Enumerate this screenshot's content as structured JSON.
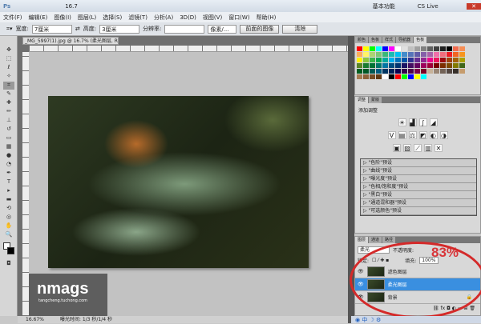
{
  "titlebar": {
    "app_logo": "Ps",
    "zoom_value": "16.7",
    "workspace": "基本功能",
    "cs_live": "CS Live"
  },
  "menu": [
    "文件(F)",
    "编辑(E)",
    "图像(I)",
    "图层(L)",
    "选择(S)",
    "滤镜(T)",
    "分析(A)",
    "3D(D)",
    "视图(V)",
    "窗口(W)",
    "帮助(H)"
  ],
  "options": {
    "width_label": "宽度:",
    "width_value": "7厘米",
    "height_label": "高度:",
    "height_value": "3厘米",
    "resolution_label": "分辨率:",
    "resolution_value": "",
    "unit_value": "像素/...",
    "front_image_button": "前面的图像",
    "clear_button": "清除"
  },
  "document": {
    "tab_title": "_MG_5997(1).jpg @ 16.7% (柔光图层, RGB/8*) ×",
    "zoom_status": "16.67%",
    "status_text": "曝光时间: 1/3 秒/1/4 秒"
  },
  "watermark": {
    "brand": "nmags",
    "url": "tangcheng.tuchong.com"
  },
  "swatches": {
    "tabs": [
      "颜色",
      "色板",
      "样式",
      "导航器",
      "色板"
    ],
    "colors": [
      "#ff0000",
      "#ffff00",
      "#00ff00",
      "#00ffff",
      "#0000ff",
      "#ff00ff",
      "#ffffff",
      "#e0e0e0",
      "#c0c0c0",
      "#a0a0a0",
      "#808080",
      "#606060",
      "#404040",
      "#202020",
      "#000000",
      "#f26c4f",
      "#f68e55",
      "#fbaf5c",
      "#fff467",
      "#acd372",
      "#7cc576",
      "#3bb878",
      "#1abbb4",
      "#00bff3",
      "#438ccb",
      "#5574b9",
      "#605ca8",
      "#855fa8",
      "#a763a8",
      "#f06ea9",
      "#f26d7d",
      "#ed1c24",
      "#f26522",
      "#f7941d",
      "#fff200",
      "#8dc63f",
      "#39b54a",
      "#00a651",
      "#00a99d",
      "#00aeef",
      "#0072bc",
      "#0054a6",
      "#2e3192",
      "#662d91",
      "#92278f",
      "#ec008c",
      "#ed145b",
      "#9e0b0f",
      "#a0410d",
      "#a36209",
      "#aba000",
      "#598527",
      "#197b30",
      "#007236",
      "#00746b",
      "#0076a3",
      "#004b80",
      "#003471",
      "#1b1464",
      "#440e62",
      "#630460",
      "#9e005d",
      "#9e0039",
      "#790000",
      "#7b2e00",
      "#7d4900",
      "#827b00",
      "#406618",
      "#005e20",
      "#005826",
      "#005952",
      "#005b7f",
      "#003663",
      "#002157",
      "#0d004c",
      "#32004b",
      "#4b0049",
      "#7b0046",
      "#7a0026",
      "#c7b299",
      "#998675",
      "#736357",
      "#534741",
      "#37302a",
      "#c69c6d",
      "#a67c52",
      "#8c6239",
      "#754c24",
      "#603913",
      "#ffffff",
      "#000000",
      "#ff0000",
      "#00ff00",
      "#0000ff",
      "#ffff00",
      "#00ffff"
    ]
  },
  "adjustments": {
    "tabs": [
      "调整",
      "蒙版"
    ],
    "title": "添加调整",
    "row1": [
      "☀",
      "▟",
      "∫",
      "◢"
    ],
    "row2": [
      "V",
      "▤",
      "⚖",
      "◩",
      "◐",
      "◑"
    ],
    "row3": [
      "▣",
      "▨",
      "⟋",
      "▥",
      "✕"
    ],
    "presets": [
      "\"色阶\"预设",
      "\"曲线\"预设",
      "\"曝光度\"预设",
      "\"色相/饱和度\"预设",
      "\"黑白\"预设",
      "\"通道混和器\"预设",
      "\"可选颜色\"预设"
    ]
  },
  "layers": {
    "tabs": [
      "图层",
      "通道",
      "路径"
    ],
    "blend_mode": "柔光",
    "opacity_label": "不透明度:",
    "opacity_annotation": "83%",
    "lock_label": "锁定:",
    "fill_label": "填充:",
    "fill_value": "100%",
    "items": [
      {
        "name": "滤色图层",
        "selected": false
      },
      {
        "name": "柔光图层",
        "selected": true
      },
      {
        "name": "背景",
        "selected": false
      }
    ]
  },
  "colors": {
    "selection": "#3a8fe0",
    "annotation_red": "#d42a2a"
  }
}
